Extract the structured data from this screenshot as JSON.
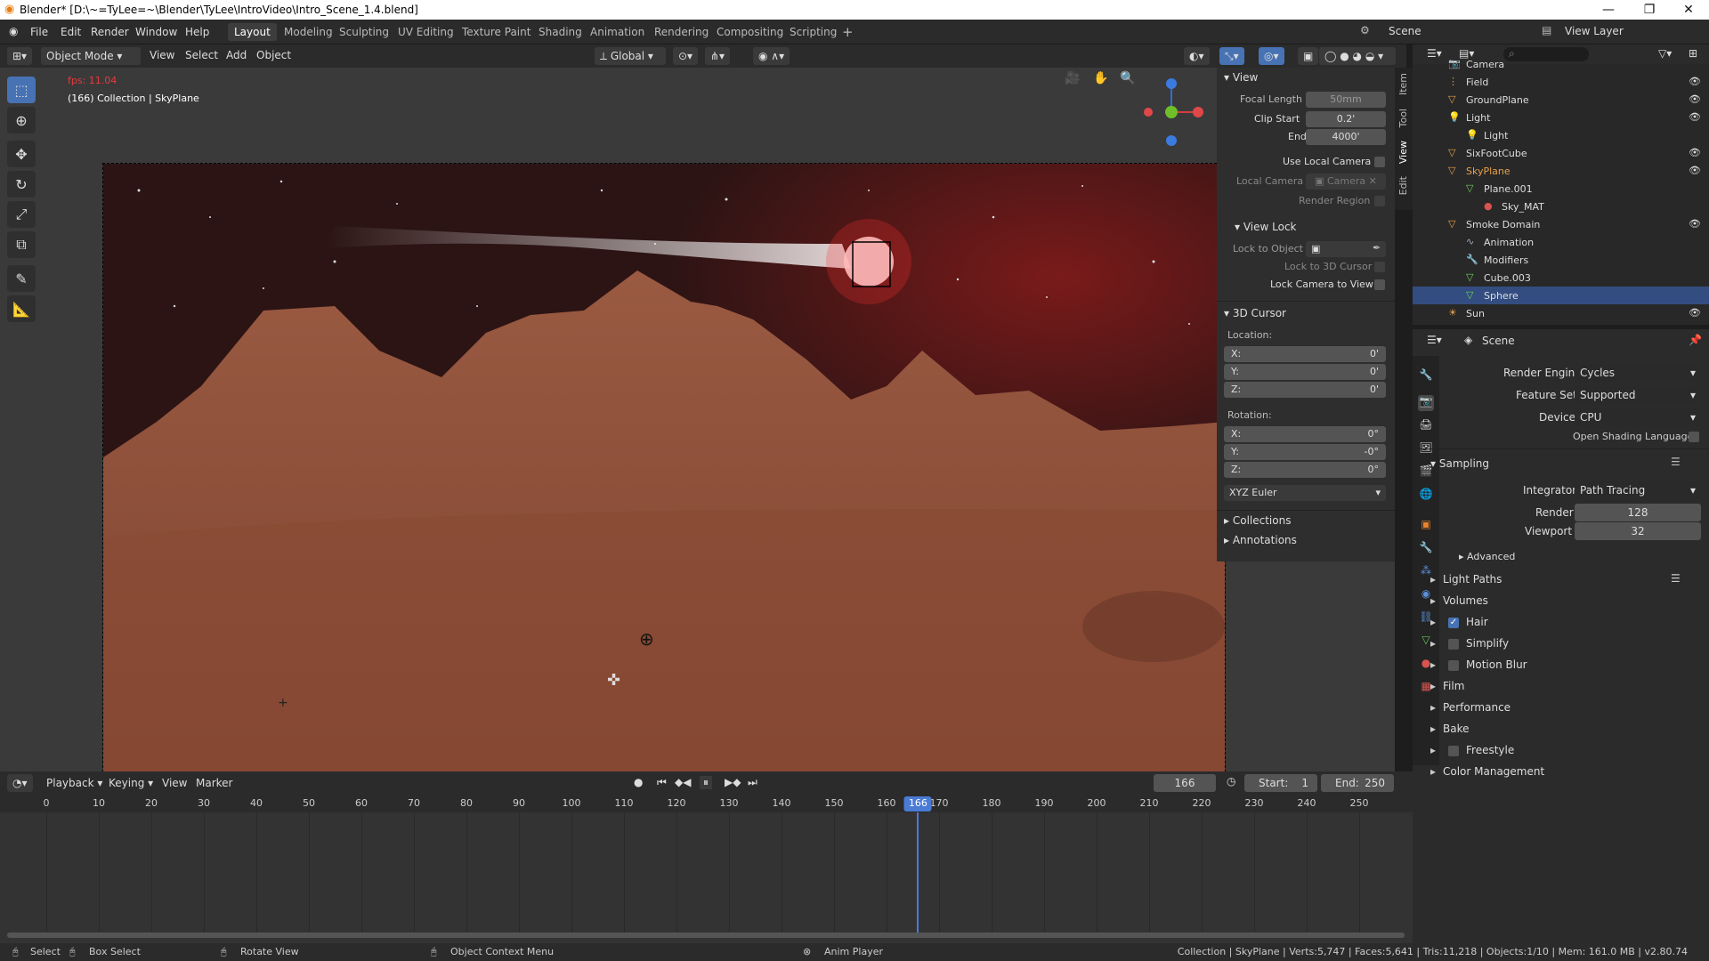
{
  "window": {
    "title": "Blender* [D:\\~=TyLee=~\\Blender\\TyLee\\IntroVideo\\Intro_Scene_1.4.blend]",
    "min": "—",
    "max": "❐",
    "close": "✕"
  },
  "menus": [
    "File",
    "Edit",
    "Render",
    "Window",
    "Help"
  ],
  "workspaces": [
    "Layout",
    "Modeling",
    "Sculpting",
    "UV Editing",
    "Texture Paint",
    "Shading",
    "Animation",
    "Rendering",
    "Compositing",
    "Scripting"
  ],
  "scene": {
    "label": "Scene",
    "view_layer": "View Layer"
  },
  "viewport_header": {
    "mode": "Object Mode",
    "menus": [
      "View",
      "Select",
      "Add",
      "Object"
    ],
    "orientation": "Global"
  },
  "overlay": {
    "fps": "fps: 11.04",
    "info": "(166) Collection | SkyPlane"
  },
  "npanel": {
    "view_title": "View",
    "focal_length_label": "Focal Length",
    "focal_length": "50mm",
    "clip_start_label": "Clip Start",
    "clip_start": "0.2'",
    "end_label": "End",
    "end": "4000'",
    "use_local_camera": "Use Local Camera",
    "local_camera_label": "Local Camera",
    "local_camera": "Camera",
    "render_region": "Render Region",
    "view_lock_title": "View Lock",
    "lock_to_object": "Lock to Object",
    "lock_to_3d_cursor": "Lock to 3D Cursor",
    "lock_camera_to_view": "Lock Camera to View",
    "cursor_title": "3D Cursor",
    "location_label": "Location:",
    "loc": [
      {
        "axis": "X:",
        "val": "0'"
      },
      {
        "axis": "Y:",
        "val": "0'"
      },
      {
        "axis": "Z:",
        "val": "0'"
      }
    ],
    "rotation_label": "Rotation:",
    "rot": [
      {
        "axis": "X:",
        "val": "0°"
      },
      {
        "axis": "Y:",
        "val": "-0°"
      },
      {
        "axis": "Z:",
        "val": "0°"
      }
    ],
    "rotation_mode": "XYZ Euler",
    "collections": "Collections",
    "annotations": "Annotations",
    "tabs": [
      "Item",
      "Tool",
      "View",
      "Edit"
    ]
  },
  "outliner": {
    "items": [
      {
        "label": "Camera",
        "indent": 1,
        "icon": "camera-icon"
      },
      {
        "label": "Field",
        "indent": 1,
        "icon": "field-icon"
      },
      {
        "label": "GroundPlane",
        "indent": 1,
        "icon": "mesh-object-icon"
      },
      {
        "label": "Light",
        "indent": 1,
        "icon": "light-icon"
      },
      {
        "label": "Light",
        "indent": 2,
        "icon": "light-data-icon"
      },
      {
        "label": "SixFootCube",
        "indent": 1,
        "icon": "mesh-object-icon"
      },
      {
        "label": "SkyPlane",
        "indent": 1,
        "icon": "mesh-object-icon"
      },
      {
        "label": "Plane.001",
        "indent": 2,
        "icon": "mesh-data-icon"
      },
      {
        "label": "Sky_MAT",
        "indent": 3,
        "icon": "material-icon"
      },
      {
        "label": "Smoke Domain",
        "indent": 1,
        "icon": "mesh-object-icon"
      },
      {
        "label": "Animation",
        "indent": 2,
        "icon": "animation-icon"
      },
      {
        "label": "Modifiers",
        "indent": 2,
        "icon": "wrench-icon"
      },
      {
        "label": "Cube.003",
        "indent": 2,
        "icon": "mesh-data-icon"
      },
      {
        "label": "Sphere",
        "indent": 2,
        "icon": "mesh-data-icon"
      },
      {
        "label": "Sun",
        "indent": 1,
        "icon": "sun-icon"
      }
    ]
  },
  "properties": {
    "context": "Scene",
    "render_engine_label": "Render Engine",
    "render_engine": "Cycles",
    "feature_set_label": "Feature Set",
    "feature_set": "Supported",
    "device_label": "Device",
    "device": "CPU",
    "osl": "Open Shading Language",
    "sampling": "Sampling",
    "integrator_label": "Integrator",
    "integrator": "Path Tracing",
    "render_label": "Render",
    "render": "128",
    "viewport_label": "Viewport",
    "viewport": "32",
    "advanced": "Advanced",
    "sections": [
      "Light Paths",
      "Volumes",
      "Hair",
      "Simplify",
      "Motion Blur",
      "Film",
      "Performance",
      "Bake",
      "Freestyle",
      "Color Management"
    ]
  },
  "timeline": {
    "menus": [
      "Playback",
      "Keying",
      "View",
      "Marker"
    ],
    "current_frame": "166",
    "start_label": "Start:",
    "start": "1",
    "end_label": "End:",
    "end": "250",
    "ticks": [
      "0",
      "10",
      "20",
      "30",
      "40",
      "50",
      "60",
      "70",
      "80",
      "90",
      "100",
      "110",
      "120",
      "130",
      "140",
      "150",
      "160",
      "170",
      "180",
      "190",
      "200",
      "210",
      "220",
      "230",
      "240",
      "250"
    ],
    "playhead": "166"
  },
  "status": {
    "select": "Select",
    "box_select": "Box Select",
    "rotate_view": "Rotate View",
    "context_menu": "Object Context Menu",
    "anim_player": "Anim Player",
    "stats": "Collection | SkyPlane | Verts:5,747 | Faces:5,641 | Tris:11,218 | Objects:1/10 | Mem: 161.0 MB | v2.80.74"
  }
}
